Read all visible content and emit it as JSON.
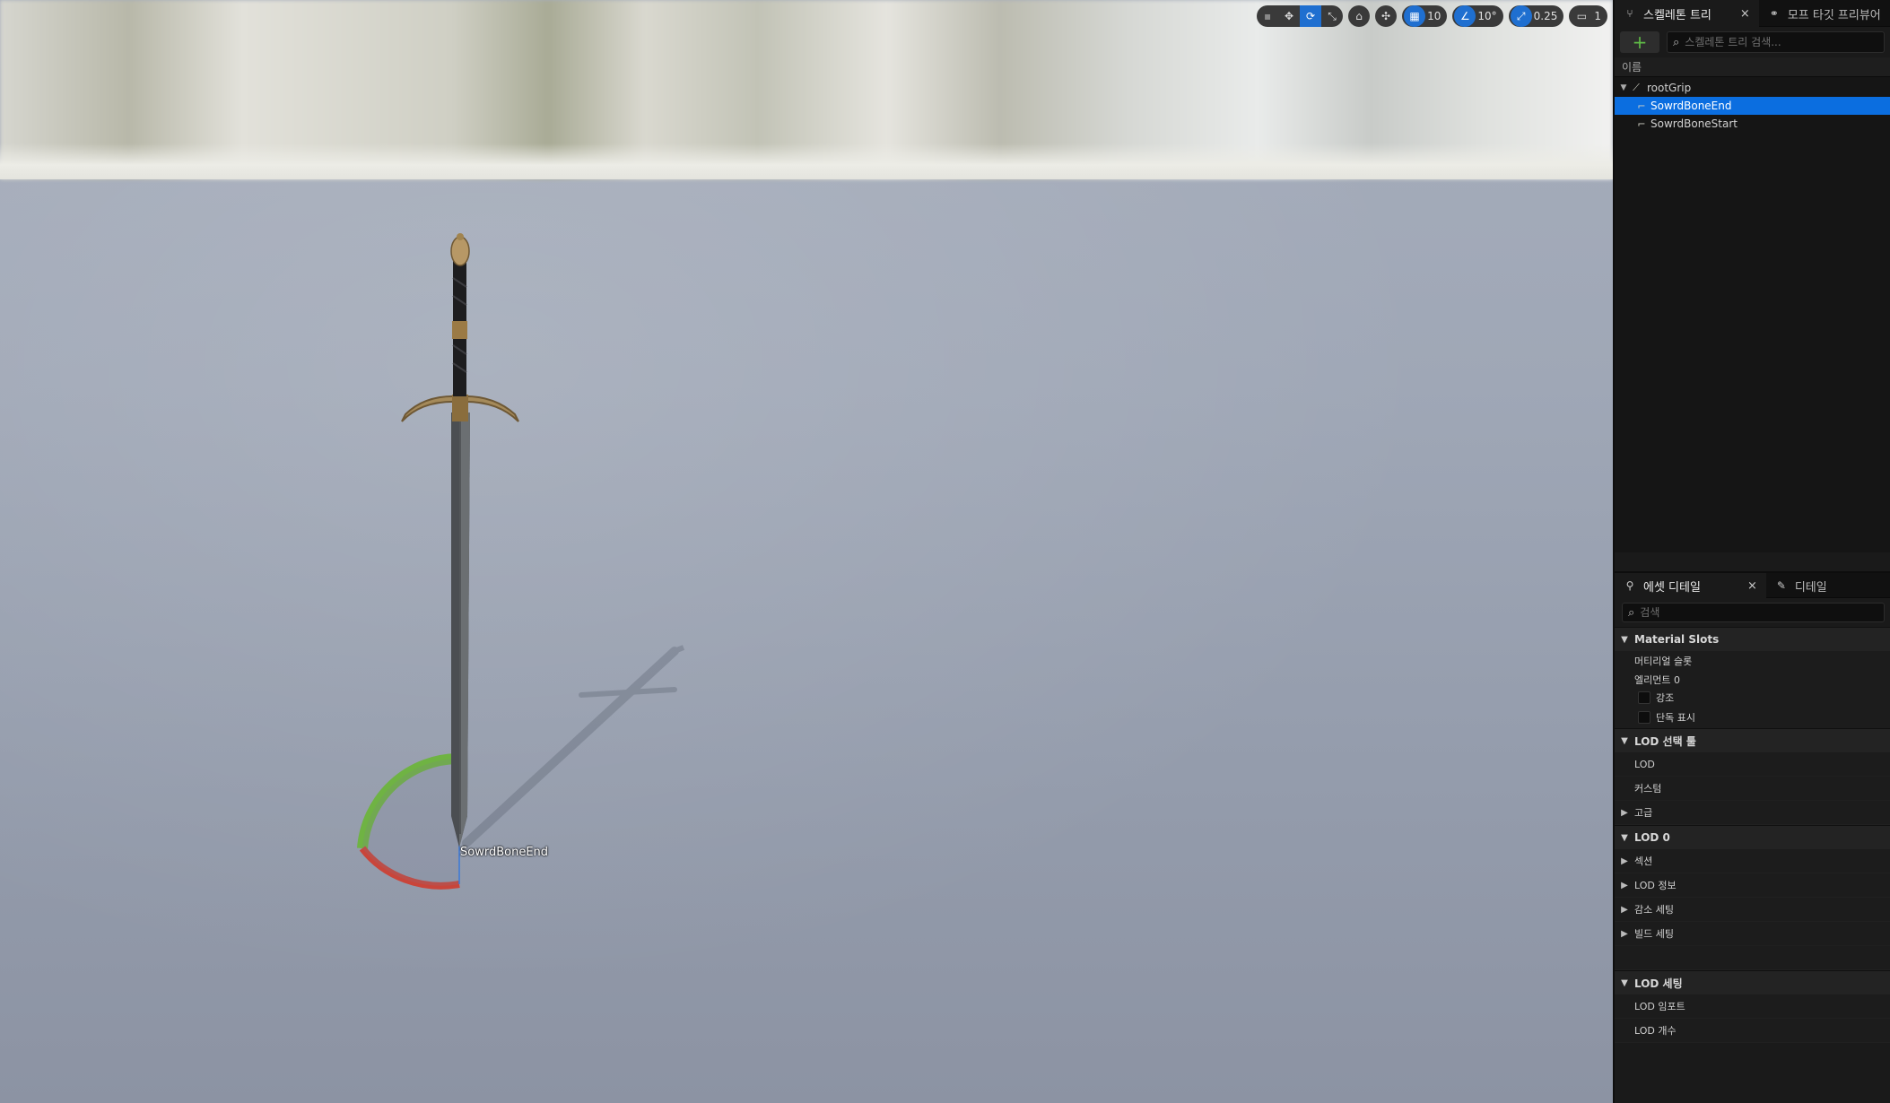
{
  "viewport": {
    "toolbar": {
      "grid_snap_value": "10",
      "angle_snap_value": "10°",
      "scale_snap_value": "0.25",
      "camera_speed_value": "1"
    },
    "selected_bone_label": "SowrdBoneEnd"
  },
  "skeleton_tree": {
    "tab_label": "스켈레톤 트리",
    "close_label": "×",
    "other_tab_label": "모프 타깃 프리뷰어",
    "search_placeholder": "스켈레톤 트리 검색...",
    "add_label": "+",
    "column_header": "이름",
    "bones": [
      {
        "name": "rootGrip"
      },
      {
        "name": "SowrdBoneEnd"
      },
      {
        "name": "SowrdBoneStart"
      }
    ]
  },
  "details": {
    "tab_label": "에셋 디테일",
    "close_label": "×",
    "other_tab_label": "디테일",
    "search_placeholder": "검색",
    "material_slots": {
      "title": "Material Slots",
      "material_slot_label": "머티리얼 슬롯",
      "element_label": "엘리먼트 0",
      "highlight_label": "강조",
      "isolate_label": "단독 표시"
    },
    "lod_picker": {
      "title": "LOD 선택 툴",
      "lod_label": "LOD",
      "custom_label": "커스텀",
      "advanced_label": "고급"
    },
    "lod0": {
      "title": "LOD 0",
      "sections_label": "섹션",
      "lod_info_label": "LOD 정보",
      "reduction_label": "감소 세팅",
      "build_label": "빌드 세팅"
    },
    "lod_settings": {
      "title": "LOD 세팅",
      "import_label": "LOD 임포트",
      "count_label": "LOD 개수"
    }
  }
}
